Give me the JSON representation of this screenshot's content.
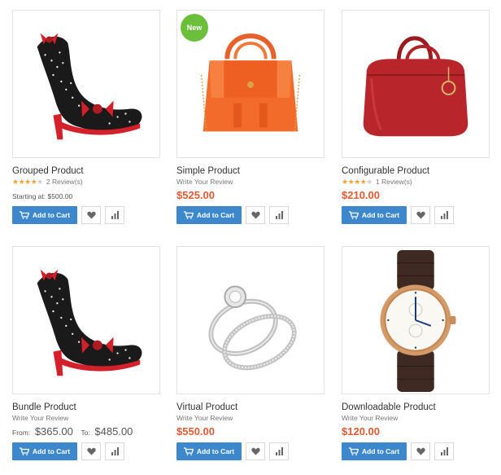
{
  "products": [
    {
      "name": "Grouped Product",
      "badge": "",
      "rating_stars": 4,
      "review_text": "2 Review(s)",
      "price_label": "Starting at: $500.00",
      "add_to_cart": "Add to Cart",
      "image": "red-polka-dot-heel"
    },
    {
      "name": "Simple Product",
      "badge": "New",
      "review_text": "Write Your Review",
      "price": "$525.00",
      "add_to_cart": "Add to Cart",
      "image": "orange-handbag"
    },
    {
      "name": "Configurable Product",
      "badge": "",
      "rating_stars": 4,
      "review_text": "1 Review(s)",
      "price": "$210.00",
      "add_to_cart": "Add to Cart",
      "image": "red-leather-bag"
    },
    {
      "name": "Bundle Product",
      "badge": "",
      "review_text": "Write Your Review",
      "from_label": "From:",
      "from_price": "$365.00",
      "to_label": "To:",
      "to_price": "$485.00",
      "add_to_cart": "Add to Cart",
      "image": "red-polka-dot-heel"
    },
    {
      "name": "Virtual Product",
      "badge": "",
      "review_text": "Write Your Review",
      "price": "$550.00",
      "add_to_cart": "Add to Cart",
      "image": "diamond-rings"
    },
    {
      "name": "Downloadable Product",
      "badge": "",
      "review_text": "Write Your Review",
      "price": "$120.00",
      "add_to_cart": "Add to Cart",
      "image": "gold-watch"
    }
  ],
  "icons": {
    "cart": "cart-icon",
    "wishlist": "heart-icon",
    "compare": "bar-chart-icon"
  },
  "colors": {
    "price": "#e05a33",
    "button": "#3d87cc",
    "badge": "#6cbf3a",
    "stars": "#f0a33a"
  }
}
